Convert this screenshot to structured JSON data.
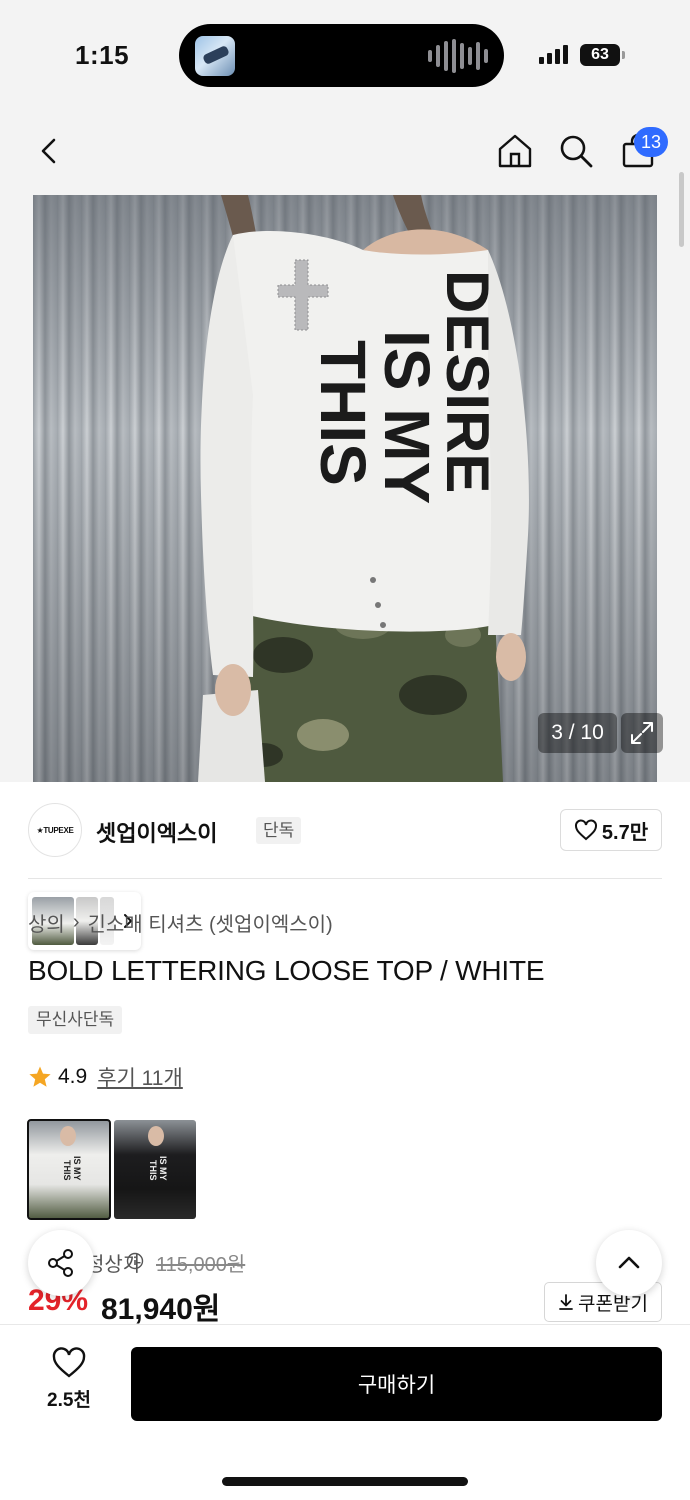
{
  "status_bar": {
    "time": "1:15",
    "battery": "63"
  },
  "nav": {
    "cart_count": "13"
  },
  "gallery": {
    "counter": "3 / 10"
  },
  "brand": {
    "logo_text": "★TUPEXE",
    "name": "셋업이엑스이",
    "tag": "단독",
    "likes": "5.7만"
  },
  "breadcrumb": {
    "category": "상의",
    "separator": "›",
    "subcategory": "긴소매 티셔츠 (셋업이엑스이)"
  },
  "product": {
    "title": "BOLD LETTERING LOOSE TOP / WHITE",
    "exclusive_tag": "무신사단독",
    "rating": "4.9",
    "review_link": "후기 11개"
  },
  "price": {
    "normal_label": "정상가",
    "original": "115,000원",
    "discount": "29%",
    "sale": "81,940원",
    "coupon_label": "쿠폰받기"
  },
  "bottom": {
    "wish_count": "2.5천",
    "buy_label": "구매하기"
  },
  "colors": {
    "accent_blue": "#2f6bff",
    "discount_red": "#e4232a",
    "star": "#f5a623"
  }
}
